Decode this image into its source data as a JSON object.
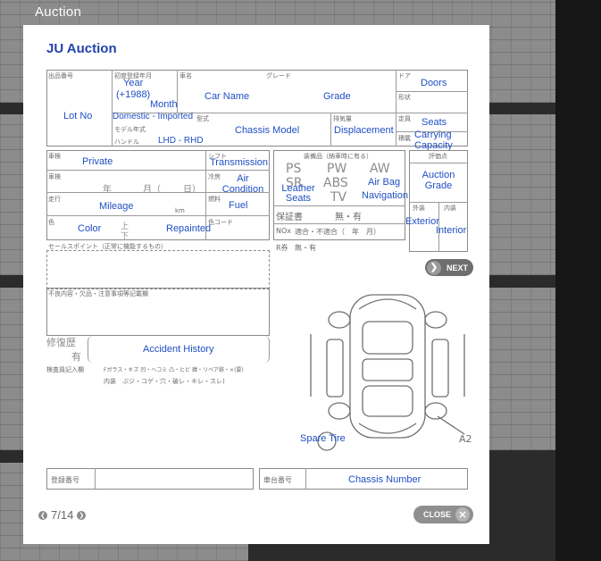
{
  "background": {
    "title": "Auction"
  },
  "sheet": {
    "title": "JU Auction",
    "labels": {
      "year": "Year",
      "year_sub": "(+1988)",
      "month": "Month",
      "car_name": "Car Name",
      "grade": "Grade",
      "doors": "Doors",
      "lot_no": "Lot No",
      "domestic_imported": "Domestic - Imported",
      "lhd_rhd": "LHD - RHD",
      "chassis_model": "Chassis Model",
      "displacement": "Displacement",
      "seats": "Seats",
      "carrying_capacity": "Carrying Capacity",
      "private": "Private",
      "transmission": "Transmission",
      "air_condition": "Air Condition",
      "leather_seats": "Leather Seats",
      "air_bag": "Air Bag",
      "navigation": "Navigation",
      "auction_grade": "Auction Grade",
      "mileage": "Mileage",
      "fuel": "Fuel",
      "color": "Color",
      "repainted": "Repainted",
      "exterior": "Exterior",
      "interior": "Interior",
      "accident_history": "Accident History",
      "spare_tire": "Spare Tire",
      "chassis_number": "Chassis Number"
    },
    "jp": {
      "lot_hdr": "出品番号",
      "year_hdr": "初度登録年月",
      "car_hdr": "車名",
      "grade_hdr": "グレード",
      "door_hdr": "ドア",
      "shape_hdr": "形状",
      "model_year": "モデル年式",
      "handle": "ハンドル",
      "katashiki": "型式",
      "haiki": "排気量",
      "teiin": "定員",
      "sekisai": "積載",
      "shaken": "車検",
      "soukou": "走行",
      "iro": "色",
      "shift": "シフト",
      "reibou": "冷房",
      "nenryou": "燃料",
      "iro_code": "色コード",
      "soubi": "装備品（納車時に有る）",
      "hoshousho": "保証書",
      "nox": "NOx",
      "nox_val": "適合・不適合（　年　月）",
      "recycle": "R券",
      "nashi_ari": "無・有",
      "hyouka": "評価点",
      "gaisou": "外装",
      "naisou": "内装",
      "sales_point": "セールスポイント（正常に機能するもの）",
      "defects": "不良内容・欠品・注意事項等記載欄",
      "repair": "修復歴",
      "ari": "有",
      "inspector": "検査員記入欄",
      "inspect_line1": "Fガラス・キズ 凹・ヘコミ 凸・ヒビ 錆・リペア跡・×(要)",
      "inspect_line2": "内装　ぶジ・コゲ・穴・破レ・キレ・スレ)",
      "reg_no": "登録番号",
      "chassis_no": "車台番号",
      "nen": "年",
      "tsuki": "月（",
      "nichi": "日）",
      "km": "km",
      "ue": "上",
      "shita": "下"
    },
    "equipment": {
      "ps": "PS",
      "pw": "PW",
      "aw": "AW",
      "sr": "SR",
      "abs": "ABS",
      "tv": "TV"
    }
  },
  "controls": {
    "next_label": "NEXT",
    "page_current": "7",
    "page_total": "14",
    "page_sep": "/",
    "close_label": "CLOSE"
  },
  "colors": {
    "label_blue": "#1f4fc4",
    "backdrop": "#2b2b2b"
  },
  "icons": [
    "chevron-right-icon",
    "chevron-left-icon",
    "close-icon",
    "car-diagram-icon"
  ]
}
